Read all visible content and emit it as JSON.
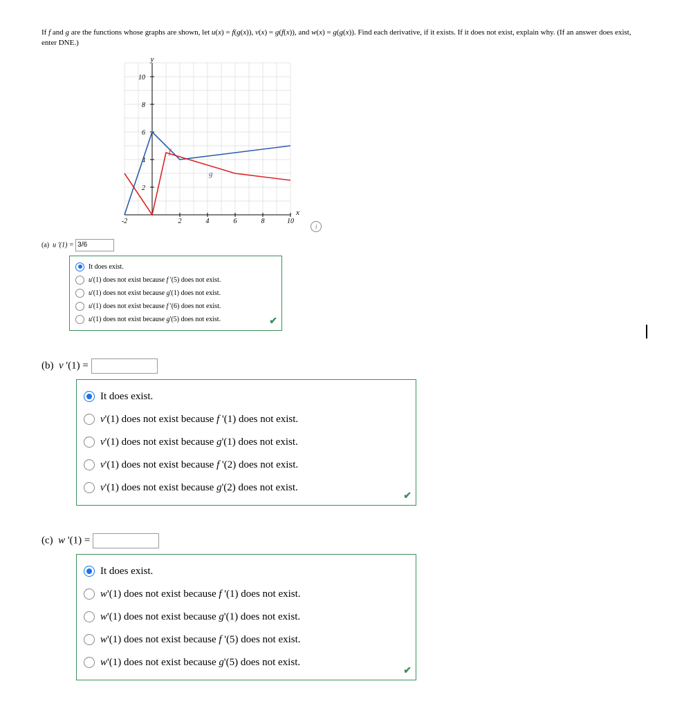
{
  "question": "If f and g are the functions whose graphs are shown, let u(x) = f(g(x)), v(x) = g(f(x)), and w(x) = g(g(x)). Find each derivative, if it exists. If it does not exist, explain why. (If an answer does exist, enter DNE.)",
  "info_icon": "i",
  "chart_data": {
    "type": "line",
    "title": "",
    "xlabel": "x",
    "ylabel": "y",
    "xlim": [
      -2,
      10
    ],
    "ylim": [
      0,
      10
    ],
    "xticks": [
      -2,
      2,
      4,
      6,
      8,
      10
    ],
    "yticks": [
      2,
      4,
      6,
      8,
      10
    ],
    "series": [
      {
        "name": "f",
        "color": "#d22",
        "points": [
          [
            -2,
            3
          ],
          [
            0,
            0
          ],
          [
            1,
            4.5
          ],
          [
            6,
            3
          ],
          [
            10,
            2.5
          ]
        ]
      },
      {
        "name": "g",
        "color": "#2a5db0",
        "points": [
          [
            -2,
            0
          ],
          [
            0,
            6
          ],
          [
            2,
            4
          ],
          [
            10,
            5
          ]
        ]
      }
    ],
    "labels": [
      {
        "text": "f",
        "x": 1.2,
        "y": 4.2,
        "color": "#d22"
      },
      {
        "text": "g",
        "x": 4,
        "y": 3,
        "color": "#2a5db0"
      }
    ]
  },
  "parts": {
    "a": {
      "label": "(a)",
      "prompt": "u '(1) =",
      "value": "3/6",
      "choices": [
        "It does exist.",
        "u'(1) does not exist because f '(5) does not exist.",
        "u'(1) does not exist because g'(1) does not exist.",
        "u'(1) does not exist because f '(6) does not exist.",
        "u'(1) does not exist because g'(5) does not exist."
      ],
      "selected": 0
    },
    "b": {
      "label": "(b)",
      "prompt": "v '(1) =",
      "value": "",
      "choices": [
        "It does exist.",
        "v'(1) does not exist because f '(1) does not exist.",
        "v'(1) does not exist because g'(1) does not exist.",
        "v'(1) does not exist because f '(2) does not exist.",
        "v'(1) does not exist because g'(2) does not exist."
      ],
      "selected": 0
    },
    "c": {
      "label": "(c)",
      "prompt": "w '(1) =",
      "value": "",
      "choices": [
        "It does exist.",
        "w'(1) does not exist because f '(1) does not exist.",
        "w'(1) does not exist because g'(1) does not exist.",
        "w'(1) does not exist because f '(5) does not exist.",
        "w'(1) does not exist because g'(5) does not exist."
      ],
      "selected": 0
    }
  }
}
